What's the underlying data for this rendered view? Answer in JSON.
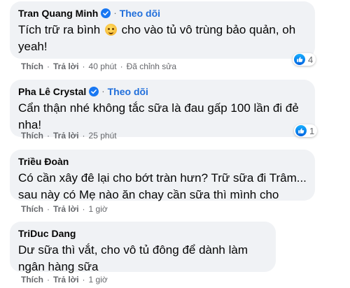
{
  "comments": [
    {
      "author": "Tran Quang Minh",
      "verified": true,
      "follow_label": "Theo dõi",
      "text_before_emoji": "Tích trữ ra bình ",
      "emoji_icon": "smiling-face-emoji",
      "text_after_emoji": " cho vào tủ vô trùng bảo quản, oh yeah!",
      "actions": {
        "like": "Thích",
        "reply": "Trả lời",
        "time": "40 phút",
        "edited": "Đã chỉnh sửa"
      },
      "reaction": {
        "icon": "like-icon",
        "count": "4"
      }
    },
    {
      "author": "Pha Lê Crystal",
      "verified": true,
      "follow_label": "Theo dõi",
      "text": "Cẩn thận nhé không tắc sữa là đau gấp 100 lần đi đẻ nha!",
      "actions": {
        "like": "Thích",
        "reply": "Trả lời",
        "time": "25 phút"
      },
      "reaction": {
        "icon": "like-icon",
        "count": "1"
      }
    },
    {
      "author": "Triều Đoàn",
      "verified": false,
      "text": "Có cần xây đê lại cho bớt tràn hưn? Trữ sữa đi Trâm... sau này có Mẹ nào ăn chay cần sữa thì mình cho",
      "actions": {
        "like": "Thích",
        "reply": "Trả lời",
        "time": "1 giờ"
      }
    },
    {
      "author": "TriDuc Dang",
      "verified": false,
      "text": "Dư sữa thì vắt, cho vô tủ đông để dành làm ngân hàng sữa",
      "actions": {
        "like": "Thích",
        "reply": "Trả lời",
        "time": "1 giờ"
      }
    }
  ],
  "colors": {
    "bubble": "#f0f2f5",
    "link": "#216fdb",
    "meta": "#65676b",
    "like_blue": "#1877f2"
  }
}
